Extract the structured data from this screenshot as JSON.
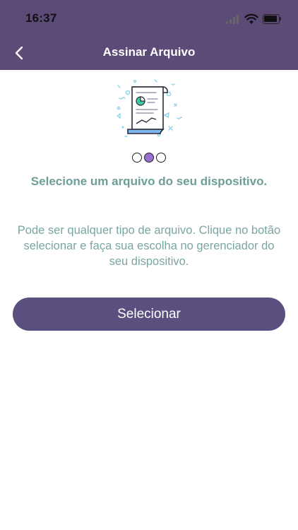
{
  "status_bar": {
    "time": "16:37"
  },
  "nav": {
    "title": "Assinar Arquivo",
    "back_icon": "chevron-left-icon"
  },
  "illustration": {
    "icon": "document-chart-icon"
  },
  "steps": {
    "count": 3,
    "active_index": 1,
    "active_color": "#9a6fd0"
  },
  "content": {
    "headline": "Selecione um arquivo do seu dispositivo.",
    "description": "Pode ser qualquer tipo de arquivo. Clique no botão selecionar e faça sua escolha no gerenciador do seu dispositivo."
  },
  "actions": {
    "select_label": "Selecionar"
  },
  "colors": {
    "header": "#5c4a77",
    "button": "#5a4f7e",
    "headline": "#6d9d97",
    "description": "#79a6a2"
  }
}
